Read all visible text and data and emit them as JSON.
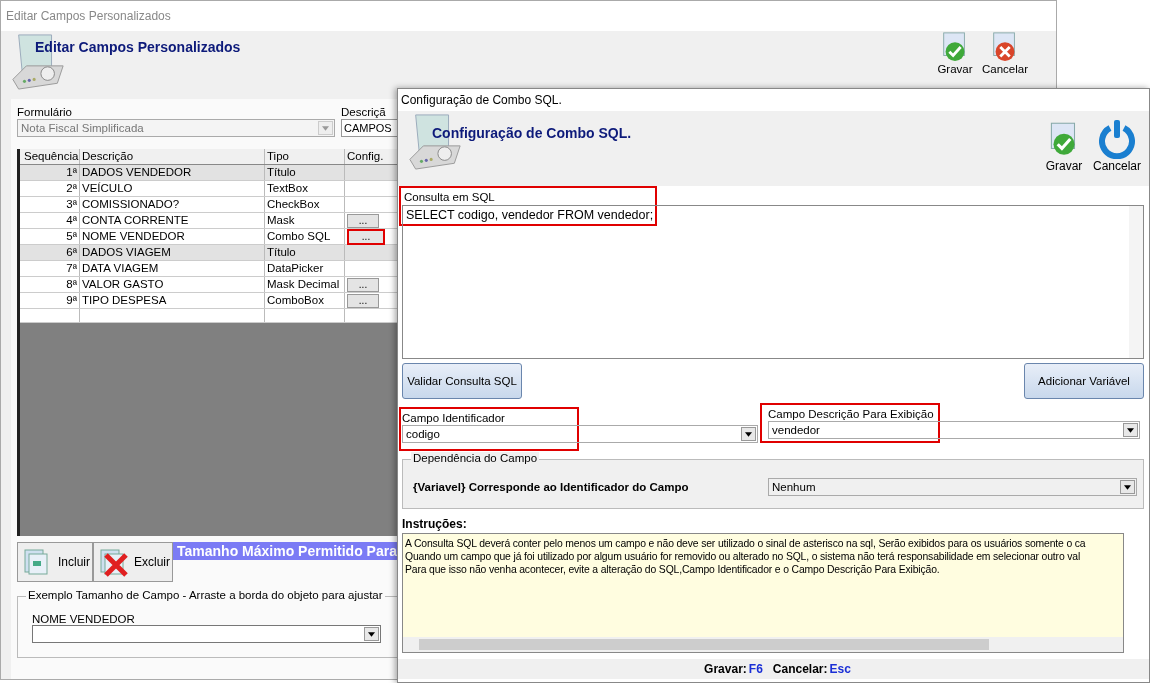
{
  "back_window": {
    "title": "Editar Campos Personalizados",
    "heading": "Editar Campos Personalizados",
    "toolbar": [
      {
        "label": "Gravar",
        "kind": "save"
      },
      {
        "label": "Cancelar",
        "kind": "cancel"
      }
    ],
    "form_label": "Formulário",
    "form_value": "Nota Fiscal Simplificada",
    "description_label": "Descriçã",
    "description_value": "CAMPOS",
    "table": {
      "columns": [
        "Sequência",
        "Descrição",
        "Tipo",
        "Config."
      ],
      "config_button_label": "...",
      "rows": [
        {
          "seq": "1ª",
          "description": "DADOS VENDEDOR",
          "type": "Título",
          "kind": "title",
          "config_button": false
        },
        {
          "seq": "2ª",
          "description": "VEÍCULO",
          "type": "TextBox",
          "kind": "field",
          "config_button": false
        },
        {
          "seq": "3ª",
          "description": "COMISSIONADO?",
          "type": "CheckBox",
          "kind": "field",
          "config_button": false
        },
        {
          "seq": "4ª",
          "description": "CONTA CORRENTE",
          "type": "Mask",
          "kind": "field",
          "config_button": true,
          "highlighted": false
        },
        {
          "seq": "5ª",
          "description": "NOME VENDEDOR",
          "type": "Combo SQL",
          "kind": "field",
          "config_button": true,
          "highlighted": true
        },
        {
          "seq": "6ª",
          "description": "DADOS VIAGEM",
          "type": "Título",
          "kind": "title",
          "config_button": false
        },
        {
          "seq": "7ª",
          "description": "DATA VIAGEM",
          "type": "DataPicker",
          "kind": "field",
          "config_button": false
        },
        {
          "seq": "8ª",
          "description": "VALOR GASTO",
          "type": "Mask Decimal",
          "kind": "field",
          "config_button": true,
          "highlighted": false
        },
        {
          "seq": "9ª",
          "description": "TIPO DESPESA",
          "type": "ComboBox",
          "kind": "field",
          "config_button": true,
          "highlighted": false
        }
      ]
    },
    "actions": [
      {
        "label": "Incluir",
        "kind": "add"
      },
      {
        "label": "Excluir",
        "kind": "delete"
      }
    ],
    "size_banner": "Tamanho Máximo Permitido Para",
    "example": {
      "legend": "Exemplo Tamanho de Campo - Arraste a borda do objeto para ajustar",
      "field_label": "NOME VENDEDOR"
    }
  },
  "front_window": {
    "title": "Configuração de Combo SQL.",
    "heading": "Configuração de Combo SQL.",
    "toolbar": [
      {
        "label": "Gravar",
        "kind": "save"
      },
      {
        "label": "Cancelar",
        "kind": "power"
      }
    ],
    "sql": {
      "label": "Consulta em SQL",
      "value": "SELECT codigo, vendedor FROM vendedor;",
      "highlighted": true
    },
    "buttons": [
      "Validar Consulta SQL",
      "Adicionar Variável"
    ],
    "id_field": {
      "label": "Campo Identificador",
      "value": "codigo",
      "highlighted": true
    },
    "display_field": {
      "label": "Campo Descrição Para Exibição",
      "value": "vendedor",
      "highlighted": true
    },
    "dependency": {
      "legend": "Dependência do Campo",
      "text": "{Variavel} Corresponde ao Identificador do Campo",
      "value": "Nenhum"
    },
    "instructions": {
      "label": "Instruções:",
      "lines": [
        "A Consulta SQL deverá conter pelo menos um campo e não deve ser utilizado o sinal de asterisco na sql, Serão exibidos para os usuários somente o ca",
        "Quando um campo que já foi utilizado por algum usuário for removido ou alterado no SQL, o sistema não terá responsabilidade em selecionar outro val",
        "Para que isso não venha acontecer, evite a alteração do SQL,Campo Identificador e o Campo Descrição Para Exibição."
      ]
    },
    "shortcuts": [
      {
        "label": "Gravar:",
        "key": "F6"
      },
      {
        "label": "Cancelar:",
        "key": "Esc"
      }
    ]
  }
}
